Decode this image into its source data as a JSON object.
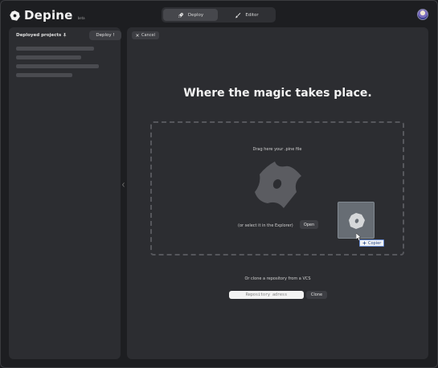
{
  "app": {
    "name": "Depine",
    "badge": "beta"
  },
  "mode_switch": {
    "tabs": [
      {
        "label": "Deploy",
        "icon": "rocket-icon",
        "active": true
      },
      {
        "label": "Editor",
        "icon": "brush-icon",
        "active": false
      }
    ]
  },
  "sidebar": {
    "title": "Deployed projects",
    "title_icon": "pin-icon",
    "deploy_button": "Deploy !",
    "loading_rows": 4
  },
  "main": {
    "cancel_button": "Cancel",
    "headline": "Where the magic takes place.",
    "dropzone": {
      "instruction": "Drag here your .pine file",
      "select_text": "(or select it in the Explorer)",
      "open_button": "Open"
    },
    "drag_feedback": {
      "label": "Copier",
      "icon": "plus-icon"
    },
    "vcs": {
      "label": "Or clone a repository from a VCS",
      "input_placeholder": "Repository adress",
      "clone_button": "Clone"
    }
  },
  "colors": {
    "background": "#1d1e21",
    "panel": "#2c2d31",
    "button": "#3d3e43",
    "accent_drag": "#6e757c"
  }
}
